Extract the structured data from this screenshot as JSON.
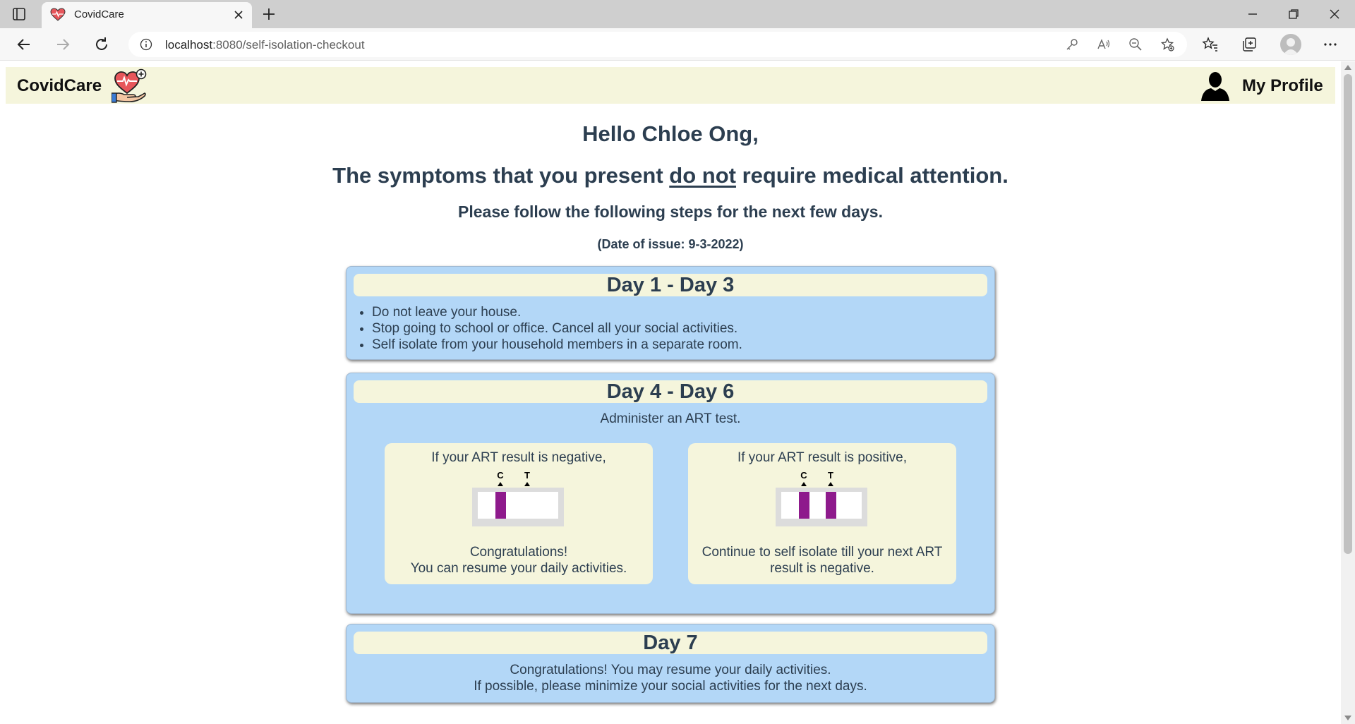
{
  "browser": {
    "tab_title": "CovidCare",
    "url_host": "localhost",
    "url_path": ":8080/self-isolation-checkout"
  },
  "navbar": {
    "brand": "CovidCare",
    "profile_label": "My Profile"
  },
  "headings": {
    "hello": "Hello Chloe Ong,",
    "symptoms_before": "The symptoms that you present ",
    "symptoms_emphasis": "do not",
    "symptoms_after": " require medical attention.",
    "steps": "Please follow the following steps for the next few days.",
    "date_issue": "(Date of issue: 9-3-2022)"
  },
  "day1_3": {
    "title": "Day 1 - Day 3",
    "items": [
      "Do not leave your house.",
      "Stop going to school or office. Cancel all your social activities.",
      "Self isolate from your household members in a separate room."
    ]
  },
  "day4_6": {
    "title": "Day 4 - Day 6",
    "intro": "Administer an ART test.",
    "negative": {
      "title": "If your ART result is negative,",
      "line1": "Congratulations!",
      "line2": "You can resume your daily activities."
    },
    "positive": {
      "title": "If your ART result is positive,",
      "line1": "Continue to self isolate till your next ART",
      "line2": "result is negative."
    },
    "kit_labels": {
      "c": "C",
      "t": "T"
    }
  },
  "day7": {
    "title": "Day 7",
    "line1": "Congratulations! You may resume your daily activities.",
    "line2": "If possible, please minimize your social activities for the next days."
  },
  "colors": {
    "navbar_bg": "#f5f5dc",
    "card_bg": "#b3d7f7",
    "text": "#2c3e50",
    "test_line": "#8e1a8c"
  }
}
